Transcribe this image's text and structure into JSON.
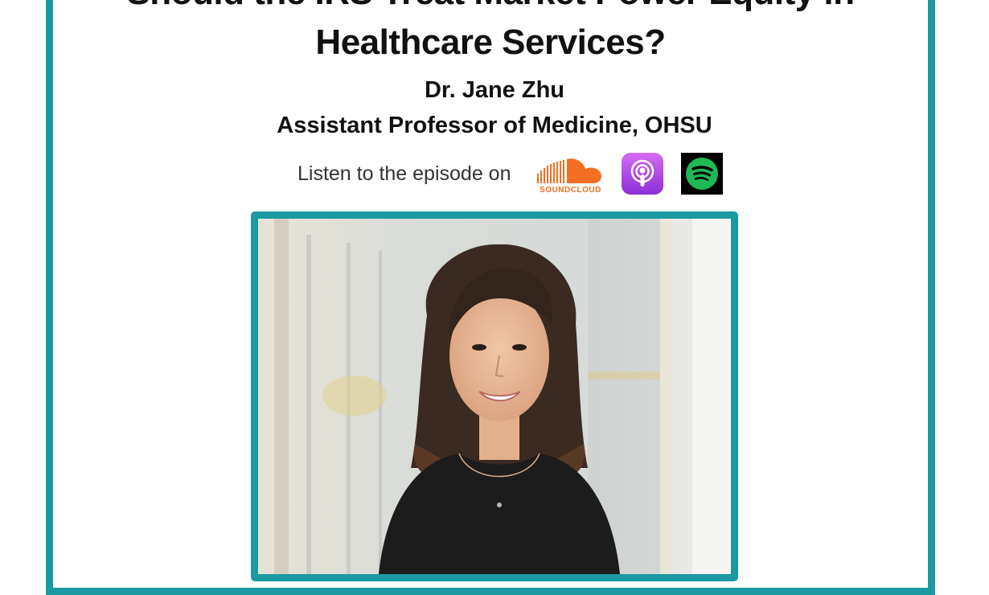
{
  "title": {
    "line1": "Should the IRS Treat Market Power Equity in",
    "line2": "Healthcare Services?"
  },
  "guest": {
    "name": "Dr. Jane Zhu",
    "role": "Assistant Professor of Medicine, OHSU"
  },
  "listen": {
    "text": "Listen to the episode on",
    "platforms": [
      {
        "icon": "soundcloud-icon",
        "label": "SOUNDCLOUD",
        "color": "#f26f23"
      },
      {
        "icon": "apple-podcasts-icon",
        "color": "#a546e6"
      },
      {
        "icon": "spotify-icon",
        "color": "#1db954"
      }
    ]
  },
  "colors": {
    "accent": "#1a9aa0"
  },
  "photo": {
    "icon": "guest-portrait-photo"
  }
}
